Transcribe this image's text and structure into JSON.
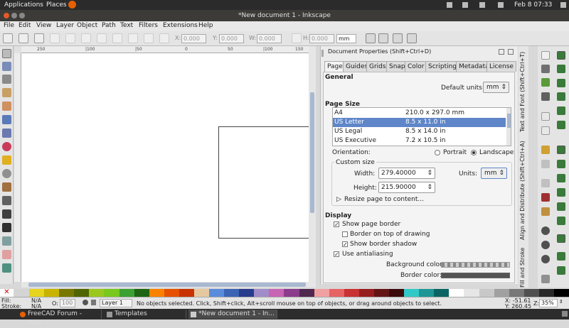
{
  "topbar": {
    "applications": "Applications",
    "places": "Places",
    "datetime": "Feb 8 07:33"
  },
  "window": {
    "title": "*New document 1 - Inkscape"
  },
  "menu": [
    "File",
    "Edit",
    "View",
    "Layer",
    "Object",
    "Path",
    "Text",
    "Filters",
    "Extensions",
    "Help"
  ],
  "controls": {
    "x_label": "X:",
    "x": "0.000",
    "y_label": "Y:",
    "y": "0.000",
    "w_label": "W:",
    "w": "0.000",
    "h_label": "H:",
    "h": "0.000",
    "unit": "mm"
  },
  "ruler_ticks": [
    "250",
    "|100",
    "|50",
    "0",
    "50",
    "|100",
    "150"
  ],
  "dock": {
    "title": "Document Properties (Shift+Ctrl+D)",
    "tabs": [
      "Page",
      "Guides",
      "Grids",
      "Snap",
      "Color",
      "Scripting",
      "Metadata",
      "License"
    ],
    "general": "General",
    "default_units_label": "Default units:",
    "default_units": "mm",
    "page_size": "Page Size",
    "sizes": [
      {
        "name": "A4",
        "dims": "210.0 x 297.0 mm"
      },
      {
        "name": "US Letter",
        "dims": "8.5 x 11.0 in"
      },
      {
        "name": "US Legal",
        "dims": "8.5 x 14.0 in"
      },
      {
        "name": "US Executive",
        "dims": "7.2 x 10.5 in"
      }
    ],
    "orientation_label": "Orientation:",
    "portrait": "Portrait",
    "landscape": "Landscape",
    "custom_size": "Custom size",
    "width_label": "Width:",
    "width": "279.40000",
    "height_label": "Height:",
    "height": "215.90000",
    "units_label": "Units:",
    "units": "mm",
    "resize": "Resize page to content...",
    "display": "Display",
    "show_border": "Show page border",
    "border_top": "Border on top of drawing",
    "border_shadow": "Show border shadow",
    "antialias": "Use antialiasing",
    "bg_color": "Background color:",
    "border_color": "Border color:"
  },
  "vtabs": [
    "Text and Font (Shift+Ctrl+T)",
    "Align and Distribute (Shift+Ctrl+A)",
    "Fill and Stroke (Shift+Ctrl+F)"
  ],
  "palette_colors": [
    "#d4d4d4",
    "#e6d41e",
    "#c8b400",
    "#787800",
    "#506400",
    "#9ac81e",
    "#78c81e",
    "#3ca032",
    "#1e6414",
    "#fa8200",
    "#e65000",
    "#c83200",
    "#e6c8a0",
    "#5a8cdc",
    "#3c64b4",
    "#283c8c",
    "#a08cc8",
    "#c864b4",
    "#8c3c8c",
    "#502850",
    "#f0a0a0",
    "#e66464",
    "#c83232",
    "#961e1e",
    "#641414",
    "#3c0a0a",
    "#32c8c8",
    "#1e9696",
    "#0a6464",
    "#ffffff",
    "#e6e6e6",
    "#c8c8c8",
    "#a0a0a0",
    "#787878",
    "#505050",
    "#282828",
    "#000000"
  ],
  "status": {
    "fill_label": "Fill:",
    "fill": "N/A",
    "stroke_label": "Stroke:",
    "stroke": "N/A",
    "opacity_label": "O:",
    "opacity": "100",
    "layer": "Layer 1",
    "message": "No objects selected. Click, Shift+click, Alt+scroll mouse on top of objects, or drag around objects to select.",
    "x": "X: -51.61",
    "y": "Y: 260.45",
    "zoom_label": "Z:",
    "zoom": "35%"
  },
  "taskbar": [
    "FreeCAD Forum - Inde...",
    "Templates",
    "*New document 1 - In..."
  ]
}
